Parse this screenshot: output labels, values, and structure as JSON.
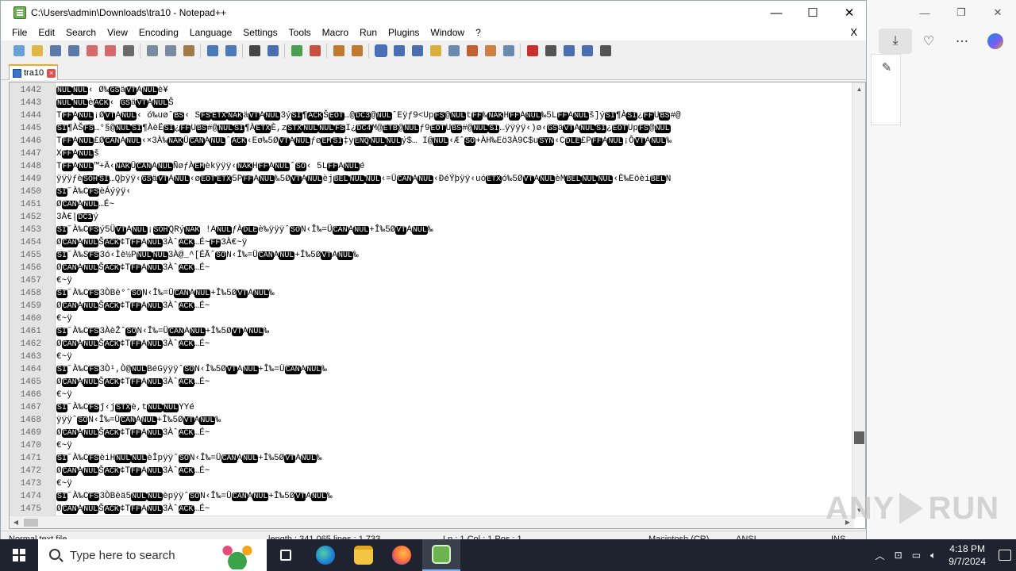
{
  "window": {
    "title": "C:\\Users\\admin\\Downloads\\tra10 - Notepad++",
    "minimize": "—",
    "maximize": "☐",
    "close": "✕"
  },
  "menu": {
    "items": [
      "File",
      "Edit",
      "Search",
      "View",
      "Encoding",
      "Language",
      "Settings",
      "Tools",
      "Macro",
      "Run",
      "Plugins",
      "Window",
      "?"
    ],
    "doc_close": "X"
  },
  "toolbar": {
    "icons": [
      "new-file-icon",
      "open-file-icon",
      "save-icon",
      "save-all-icon",
      "close-icon",
      "close-all-icon",
      "print-icon",
      "cut-icon",
      "copy-icon",
      "paste-icon",
      "undo-icon",
      "redo-icon",
      "find-icon",
      "replace-icon",
      "zoom-in-icon",
      "zoom-out-icon",
      "sync-v-icon",
      "sync-h-icon",
      "word-wrap-icon",
      "show-all-chars-icon",
      "indent-guide-icon",
      "udl-icon",
      "doc-map-icon",
      "function-list-icon",
      "folder-as-workspace-icon",
      "monitor-icon",
      "record-macro-icon",
      "stop-macro-icon",
      "play-macro-icon",
      "run-macro-multiple-icon",
      "save-macro-icon"
    ]
  },
  "tab": {
    "label": "tra10"
  },
  "editor": {
    "lines": [
      {
        "n": "1442",
        "t": "NULNUL‹ Ø‰GSäVTANULè¥"
      },
      {
        "n": "1443",
        "t": "NULNULèACK‹ GSäVTANULŠ"
      },
      {
        "n": "1444",
        "t": "TFFANUL¡ØVTANUL‹ ó‰uøˆBS‹ SFSETXNAKäVTANUL3ýSI¶ACKŠEOT…@DC3@NULˆEÿƒ9<UpFS@NULtFF‰NAKHFFANUL‰5LFFANULš]ýSI¶ÀSI¿FFUBS#@"
      },
      {
        "n": "1445",
        "t": "SI¶ÀŠFS…°§@NULSI¶ÀèËSI¿FFUBS#@NULSI¶ÀETXÈ,zSTXNULNULFSI¿DC4M@ETB@NULƒ9EOTUBS#@NULSI…ÿÿÿÿ‹)ø‹GSäVTANULSI¿EOTUpFS@NUL"
      },
      {
        "n": "1446",
        "t": "TFFANUL£ØCANANUL‹×3À‰NAKÜCANANULˆACK‹Eø‰5ØVTANULƒøEMSI‡yENQNULNULý$…  I@NUL‹ÆˆSO+ÀH‰Eö3À9C$uSYN‹CDLE£PFFANUL¡ÔVTANUL‰"
      },
      {
        "n": "1447",
        "t": "XFFANULš"
      },
      {
        "n": "1448",
        "t": "TFFANUL™+Ä‹NAKÜCANANULÑøƒÀEMèkÿÿÿ‹NAKHFFANULˆSO‹ 5LFFANULé"
      },
      {
        "n": "1449",
        "t": "ÿÿÿƒèSOHSI…Qþÿÿ‹GSäVTANUL‹øEOTETX5PFFANUL‰5ØVTANULèjBELNULNUL‹=ÜCANANUL‹ÐéÝþÿÿ‹uóETXó‰5ØVTANULèMBELNULNUL‹È‰EöèiBELN"
      },
      {
        "n": "1450",
        "t": "SI˝À‰CFSèÁýÿÿ‹"
      },
      {
        "n": "1451",
        "t": "ØCANANUL…É~"
      },
      {
        "n": "1452",
        "t": "3À€|DC1ý"
      },
      {
        "n": "1453",
        "t": "SI˝À‰CFSý5ÜVTANUL¡SOHQRýNAK !ANULƒÀDLEè‰ÿÿÿˆSON‹Î‰=ÜCANANUL+Î‰5ØVTANUL‰"
      },
      {
        "n": "1454",
        "t": "ØCANANULŠACK¢TFFANUL3ÀˆACK…É~FF3À€~ÿ"
      },
      {
        "n": "1455",
        "t": "SI˝À‰SFS3ó‹Ìè½PNULNUL3À@_^[ÉÃˆSON‹Î‰=ÜCANANUL+Î‰5ØVTANUL‰"
      },
      {
        "n": "1456",
        "t": "ØCANANULŠACK¢TFFANUL3ÀˆACK…É~"
      },
      {
        "n": "1457",
        "t": "€~ÿ"
      },
      {
        "n": "1458",
        "t": "SI˝À‰CFS3ÒBè°ˆSON‹Î‰=ÜCANANUL+Î‰5ØVTANUL‰"
      },
      {
        "n": "1459",
        "t": "ØCANANULŠACK¢TFFANUL3ÀˆACK…É~"
      },
      {
        "n": "1460",
        "t": "€~ÿ"
      },
      {
        "n": "1461",
        "t": "SI˝À‰CFS3ÀèŽˆSON‹Î‰=ÜCANANUL+Î‰5ØVTANUL‰"
      },
      {
        "n": "1462",
        "t": "ØCANANULŠACK¢TFFANUL3ÀˆACK…É~"
      },
      {
        "n": "1463",
        "t": "€~ÿ"
      },
      {
        "n": "1464",
        "t": "SI˝À‰CFS3Ò¹,Ò@NULBéGÿÿÿˆSON‹Î‰5ØVTANUL+Î‰=ÜCANANUL‰"
      },
      {
        "n": "1465",
        "t": "ØCANANULŠACK¢TFFANUL3ÀˆACK…É~"
      },
      {
        "n": "1466",
        "t": "€~ÿ"
      },
      {
        "n": "1467",
        "t": "SI˝À‰CFSĵ‹jSTXè,tNULNULYYé"
      },
      {
        "n": "1468",
        "t": "ÿÿÿˆSON‹Î‰=ÜCANANUL+Î‰5ØVTANUL‰"
      },
      {
        "n": "1469",
        "t": "ØCANANULŠACK¢TFFANUL3ÀˆACK…É~"
      },
      {
        "n": "1470",
        "t": "€~ÿ"
      },
      {
        "n": "1471",
        "t": "SI˝À‰CFSèiHNULNULèÎpÿÿˆSON‹Î‰=ÜCANANUL+Î‰5ØVTANUL‰"
      },
      {
        "n": "1472",
        "t": "ØCANANULŠACK¢TFFANUL3ÀˆACK…É~"
      },
      {
        "n": "1473",
        "t": "€~ÿ"
      },
      {
        "n": "1474",
        "t": "SI˝À‰CFS3ÒBèä5NULNULèpÿÿˆSON‹Î‰=ÜCANANUL+Î‰5ØVTANUL‰"
      },
      {
        "n": "1475",
        "t": "ØCANANULŠACK¢TFFANUL3ÀˆACK…É~"
      }
    ]
  },
  "status": {
    "type": "Normal text file",
    "length": "length : 341,065   lines : 1,733",
    "position": "Ln : 1   Col : 1   Pos : 1",
    "eol": "Macintosh (CR)",
    "encoding": "ANSI",
    "mode": "INS"
  },
  "taskbar": {
    "search_placeholder": "Type here to search",
    "time": "4:18 PM",
    "date": "9/7/2024"
  },
  "watermark": {
    "text_left": "ANY",
    "text_right": "RUN"
  },
  "colors": {
    "ctrl_bg": "#000000",
    "ctrl_fg": "#ffffff",
    "taskbar": "#1f2330",
    "accent": "#f4a81d"
  }
}
